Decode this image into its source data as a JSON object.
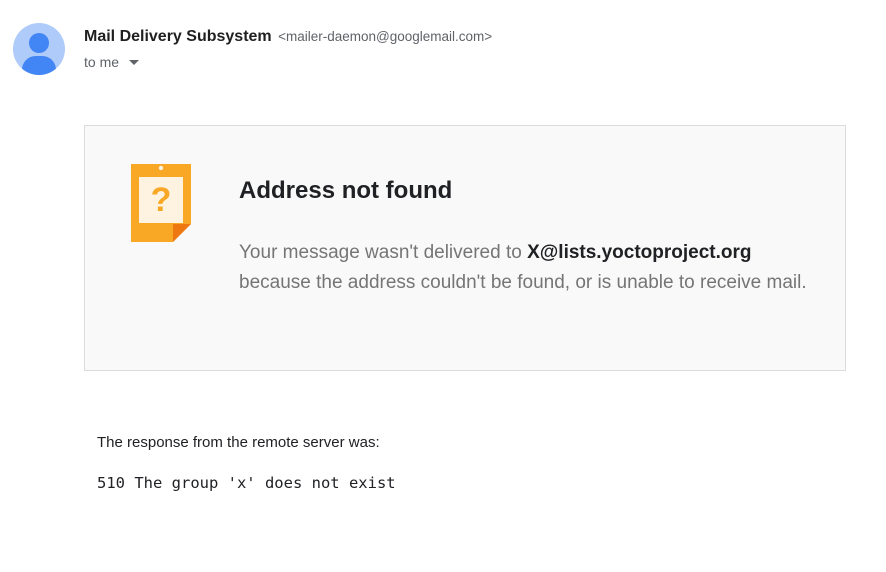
{
  "header": {
    "sender_name": "Mail Delivery Subsystem",
    "sender_email": "<mailer-daemon@googlemail.com>",
    "recipient_label": "to me"
  },
  "notice": {
    "title": "Address not found",
    "body_prefix": "Your message wasn't delivered to ",
    "address": "X@lists.yoctoproject.org",
    "body_suffix": " because the address couldn't be found, or is unable to receive mail.",
    "icon": "question-note-icon"
  },
  "response": {
    "label": "The response from the remote server was:",
    "code": "510 The group 'x' does not exist"
  },
  "colors": {
    "accent": "#4285f4",
    "warning": "#f9a825",
    "card_background": "#f9f9f9"
  }
}
